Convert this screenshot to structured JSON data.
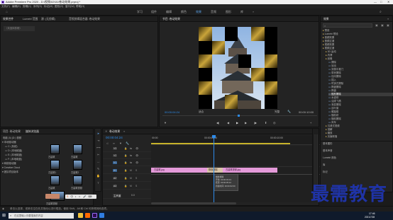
{
  "app": {
    "title": "Adobe Premiere Pro 2020 - D:\\视频\\02\\01\\卷动效果.prproj *",
    "window_controls": [
      "—",
      "□",
      "✕"
    ]
  },
  "menu": [
    "文件(F)",
    "编辑(E)",
    "剪辑(C)",
    "序列(S)",
    "标记(M)",
    "图形(G)",
    "窗口(W)",
    "帮助(H)"
  ],
  "workspaces": [
    "学习",
    "组件",
    "编辑",
    "颜色",
    "效果",
    "音频",
    "图形",
    "库"
  ],
  "workspace_active": "效果",
  "source_panel": {
    "tabs": [
      "效果控件",
      "Lumetri 范围",
      "源: (无剪辑)",
      "音频剪辑混合器: 卷动效果"
    ],
    "no_clip_text": "（未选择剪辑）"
  },
  "program_monitor": {
    "tab": "节目: 卷动效果",
    "timecode": "00:00:04:24",
    "fit": "适合",
    "quality": "完整",
    "duration": "00:00:10:00"
  },
  "effects_panel": {
    "tab": "效果",
    "search_placeholder": "",
    "tree": [
      "预设",
      "Lumetri 预设",
      "音频效果",
      "音频过渡",
      "视频效果",
      "视频过渡",
      "3D 运动",
      "内滑",
      "划像",
      "擦除",
      "划出",
      "双侧平推门",
      "带状擦除",
      "径向擦除",
      "插入",
      "时钟式擦除",
      "棋盘擦除",
      "棋盘",
      "楔形擦除",
      "水波块",
      "油漆飞溅",
      "渐变擦除",
      "百叶窗",
      "螺旋框",
      "随机块",
      "随机擦除",
      "风车",
      "沉浸式视频",
      "溶解",
      "缩放",
      "页面剥落"
    ],
    "selected_index": 18,
    "bottom_tabs": [
      "基本图形",
      "基本声音",
      "Lumetri 颜色",
      "库",
      "标记"
    ]
  },
  "project_panel": {
    "tabs": [
      "项目: 卷动效果",
      "媒体浏览器"
    ],
    "path_label": "电脑 (\\\\) (D:) 视频",
    "tree": [
      "本地驱动器",
      "C: (系统)",
      "D: (本地磁盘)",
      "E: (本地磁盘)",
      "F: (本地磁盘)",
      "网络驱动器",
      "Creative Cloud",
      "团队项目版本"
    ],
    "thumbnails": [
      {
        "label": "古建筑",
        "meta": ""
      },
      {
        "label": "古建筑",
        "meta": ""
      },
      {
        "label": "古建筑1",
        "meta": ""
      },
      {
        "label": "古建筑2",
        "meta": ""
      },
      {
        "label": "古建筑",
        "meta": ""
      },
      {
        "label": "古建筑视频",
        "meta": ""
      },
      {
        "label": "古建筑视频",
        "meta": ""
      }
    ]
  },
  "timeline": {
    "tab": "卷动效果",
    "timecode": "00:00:04:24",
    "ruler": [
      "00:00",
      "00:00:05:00",
      "00:00:10:00"
    ],
    "tracks": [
      "V3",
      "V2",
      "V1",
      "A1",
      "A2",
      "A3",
      "主声道"
    ],
    "master_value": "0.0",
    "clips": [
      {
        "name": "古建筑.jpg",
        "track": "V1"
      },
      {
        "name": "棋盘擦除",
        "track": "V1"
      },
      {
        "name": "古建筑视频.jpg",
        "track": "V1"
      }
    ],
    "tooltip": {
      "title": "棋盘擦除",
      "lines": [
        "开始: 00:00:03:13",
        "结束: 00:00:05:12",
        "持续时间: 00:00:02:00"
      ]
    }
  },
  "status_bar": {
    "text": "单击以选择，或单击空白处并拖动以进行框选。使用 Shift、Alt 和 Ctrl 可获得其他选项。"
  },
  "taskbar": {
    "search_placeholder": "在这里输入你要搜索的内容",
    "clock_time": "17:46",
    "clock_date": "2021/7/28"
  },
  "watermark": "最需教育",
  "colors": {
    "accent": "#2d8ceb",
    "clip_pink": "#e49ad9",
    "transition": "#d7c3a8",
    "playhead": "#2d8ceb",
    "render_bar": "#c7b22a",
    "watermark": "#1f33a6"
  }
}
